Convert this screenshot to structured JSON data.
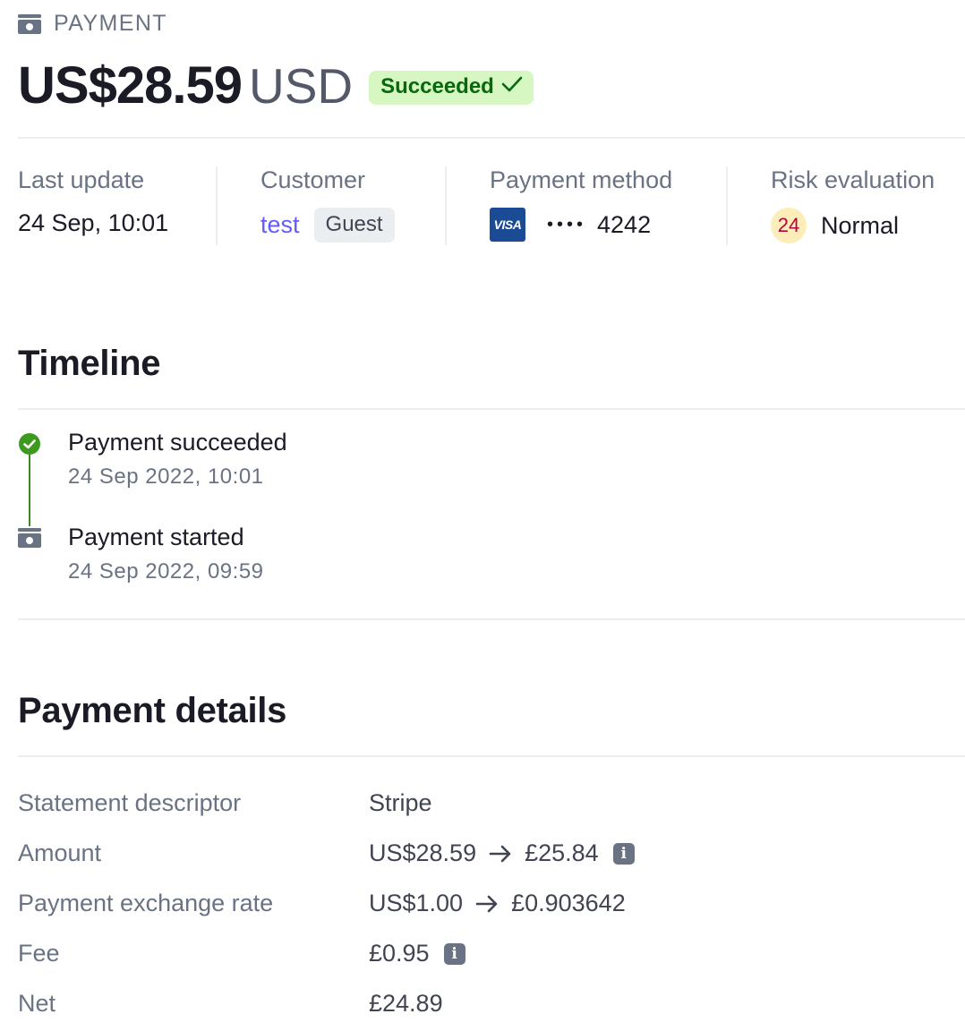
{
  "header": {
    "eyebrow": "PAYMENT",
    "amount": "US$28.59",
    "currency": "USD",
    "status": "Succeeded"
  },
  "summary": {
    "last_update": {
      "label": "Last update",
      "value": "24 Sep, 10:01"
    },
    "customer": {
      "label": "Customer",
      "name": "test",
      "badge": "Guest"
    },
    "payment_method": {
      "label": "Payment method",
      "brand": "VISA",
      "masked": "••••",
      "last4": "4242"
    },
    "risk": {
      "label": "Risk evaluation",
      "score": "24",
      "level": "Normal"
    }
  },
  "timeline": {
    "title": "Timeline",
    "events": [
      {
        "title": "Payment succeeded",
        "time": "24 Sep 2022, 10:01",
        "icon": "check-circle-icon"
      },
      {
        "title": "Payment started",
        "time": "24 Sep 2022, 09:59",
        "icon": "cash-icon"
      }
    ]
  },
  "details": {
    "title": "Payment details",
    "rows": [
      {
        "label": "Statement descriptor",
        "value": "Stripe"
      },
      {
        "label": "Amount",
        "from": "US$28.59",
        "to": "£25.84"
      },
      {
        "label": "Payment exchange rate",
        "from": "US$1.00",
        "to": "£0.903642"
      },
      {
        "label": "Fee",
        "value": "£0.95"
      },
      {
        "label": "Net",
        "value": "£24.89"
      }
    ]
  },
  "colors": {
    "success": "#05690d",
    "success_bg": "#d7f7c2",
    "link": "#635bff",
    "muted": "#6a7383",
    "visa": "#1a4b94"
  }
}
